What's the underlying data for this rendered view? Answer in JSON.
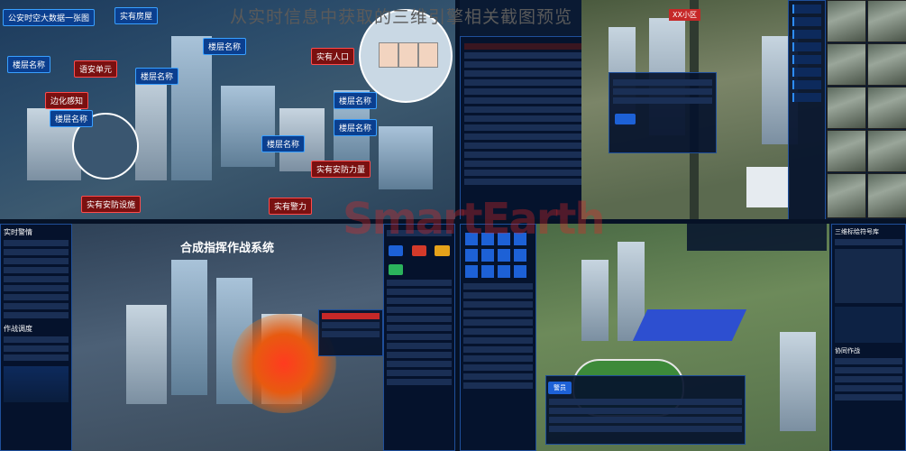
{
  "caption": "从实时信息中获取的三维引擎相关截图预览",
  "watermark": "SmartEarth",
  "panel1": {
    "title": "公安时空大数据一张图",
    "labels": [
      "实有房屋",
      "楼层名称",
      "语安单元",
      "楼层名称",
      "实有人口",
      "楼层名称",
      "边化感知",
      "楼层名称",
      "楼层名称",
      "楼层名称",
      "实有安防力量",
      "实有安防设施",
      "实有警力",
      "楼层名称"
    ]
  },
  "panel2": {
    "header": "XX小区"
  },
  "panel3": {
    "title": "合成指挥作战系统",
    "left_title": "实时警情",
    "left_section": "作战调度"
  },
  "panel4": {
    "side_title": "三维标绘符号库",
    "side_section": "协同作战",
    "bottom_tab": "警员"
  },
  "colors": {
    "accent": "#1d61d6",
    "alert": "#e03232",
    "dark_bg": "#061226"
  }
}
